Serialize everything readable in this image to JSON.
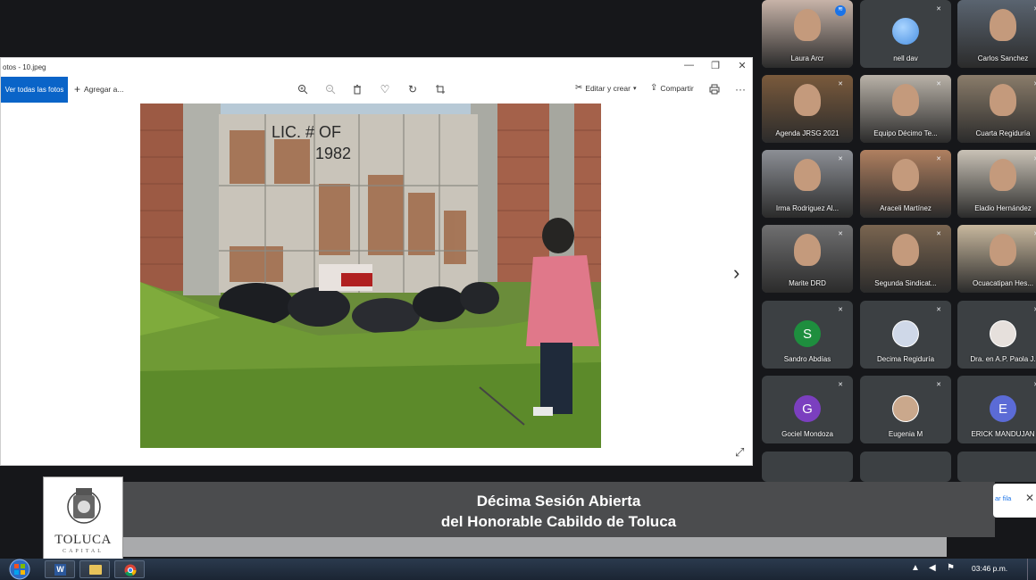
{
  "photos_window": {
    "title": "otos - 10.jpeg",
    "view_all_label": "Ver todas las fotos",
    "add_to_label": "Agregar a...",
    "edit_label": "Editar y crear",
    "share_label": "Compartir",
    "photo_text_line1": "LIC. # OF",
    "photo_text_line2": "1982"
  },
  "participants": [
    {
      "name": "Laura Arcr",
      "type": "video",
      "color": "#c7b3a8"
    },
    {
      "name": "nell dav",
      "type": "bubble",
      "color": "#4a90e2"
    },
    {
      "name": "Carlos Sanchez",
      "type": "video",
      "color": "#5a6470"
    },
    {
      "name": "Agenda JRSG 2021",
      "type": "video",
      "color": "#7a5a3c"
    },
    {
      "name": "Equipo Décimo Te...",
      "type": "video",
      "color": "#b9b2a8"
    },
    {
      "name": "Cuarta Regiduría",
      "type": "video",
      "color": "#8a7c6a"
    },
    {
      "name": "Irma Rodriguez Al...",
      "type": "video",
      "color": "#8c8f95"
    },
    {
      "name": "Araceli Martínez",
      "type": "video",
      "color": "#b08060"
    },
    {
      "name": "Eladio Hernández",
      "type": "video",
      "color": "#c9c2b6"
    },
    {
      "name": "Marite DRD",
      "type": "video",
      "color": "#6f6f70"
    },
    {
      "name": "Segunda Sindicat...",
      "type": "video",
      "color": "#7a6550"
    },
    {
      "name": "Ocuacatipan Hes...",
      "type": "video",
      "color": "#c8b89e"
    },
    {
      "name": "Sandro Abdías",
      "type": "avatar",
      "initial": "S",
      "color": "#1e8e3e"
    },
    {
      "name": "Decima Regiduría",
      "type": "photo-avatar",
      "color": "#cfd8e8"
    },
    {
      "name": "Dra. en A.P. Paola J.",
      "type": "photo-avatar",
      "color": "#e6e0dc"
    },
    {
      "name": "Gociel Mondoza",
      "type": "avatar",
      "initial": "G",
      "color": "#7b3fbf"
    },
    {
      "name": "Eugenia M",
      "type": "photo-avatar",
      "color": "#caa88c"
    },
    {
      "name": "ERICK MANDUJAN",
      "type": "avatar",
      "initial": "E",
      "color": "#5b6bd6"
    }
  ],
  "banner": {
    "line1": "Décima Sesión Abierta",
    "line2": "del Honorable Cabildo de Toluca"
  },
  "logo": {
    "name": "TOLUCA",
    "sub": "CAPITAL"
  },
  "raise_hand": {
    "label": "ar fila"
  },
  "taskbar": {
    "clock": "03:46 p.m."
  }
}
